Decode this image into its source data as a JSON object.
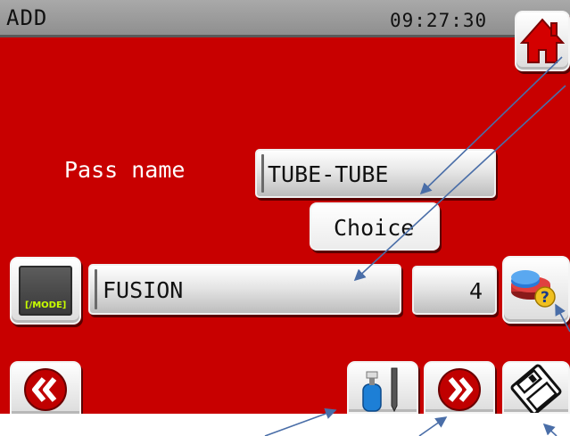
{
  "header": {
    "title": "ADD",
    "time": "09:27:30"
  },
  "form": {
    "pass_label": "Pass name",
    "pass_value": "TUBE-TUBE",
    "choice_label": "Choice",
    "mode_value": "FUSION",
    "mode_count": "4",
    "mode_badge": "[/MODE]"
  },
  "icons": {
    "home": "home-icon",
    "mode": "mode-icon",
    "help": "help-database-icon",
    "back": "double-chevron-left-icon",
    "gas": "gas-bottle-electrode-icon",
    "next": "double-chevron-right-icon",
    "save": "floppy-disk-icon"
  },
  "colors": {
    "background": "#c80000",
    "title_bar": "#9e9e9e",
    "annotation_arrow": "#4a6ea8"
  }
}
